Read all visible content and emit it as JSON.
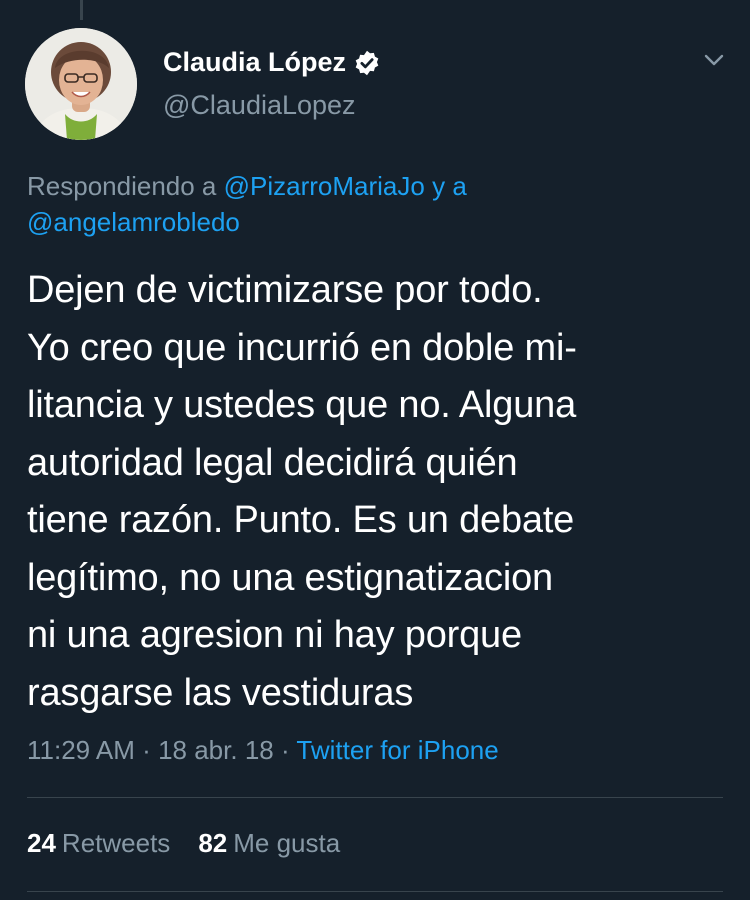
{
  "author": {
    "display_name": "Claudia López",
    "handle": "@ClaudiaLopez",
    "verified": true
  },
  "replying": {
    "prefix": "Respondiendo a",
    "mention1": "@PizarroMariaJo",
    "connector": "y a",
    "mention2": "@angelamrobledo"
  },
  "tweet": {
    "text": "Dejen de victimizarse por todo.\nYo creo que incurrió en doble mi-\nlitancia y ustedes que no. Alguna\nautoridad legal decidirá quién\ntiene razón. Punto. Es un debate\nlegítimo, no una estignatizacion\nni una agresion ni hay porque\nrasgarse las vestiduras"
  },
  "meta": {
    "time": "11:29 AM",
    "separator": "·",
    "date": "18 abr. 18",
    "source": "Twitter for iPhone"
  },
  "stats": {
    "retweets_count": "24",
    "retweets_label": "Retweets",
    "likes_count": "82",
    "likes_label": "Me gusta"
  },
  "colors": {
    "background": "#15202b",
    "accent": "#1da1f2",
    "muted": "#8899a6",
    "divider": "#38444d"
  },
  "icons": {
    "verified": "verified-badge-icon",
    "menu": "chevron-down-icon"
  }
}
